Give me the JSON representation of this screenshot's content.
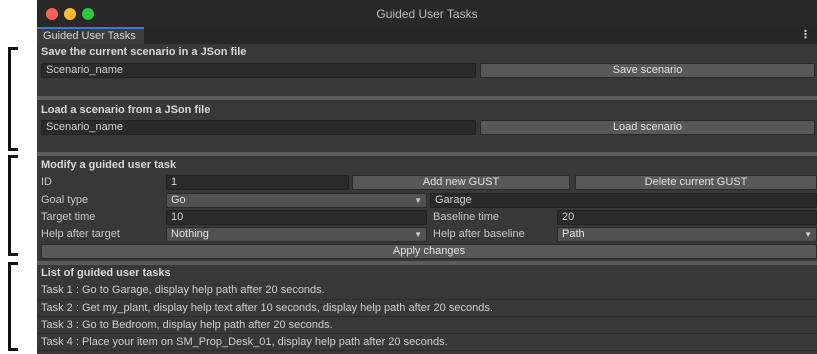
{
  "window": {
    "title": "Guided User Tasks",
    "tab_label": "Guided User Tasks",
    "tab_menu": "⋮"
  },
  "colors": {
    "close": "#ff5f57",
    "minimize": "#febc2e",
    "maximize": "#28c840",
    "accent": "#3a79d6"
  },
  "save_section": {
    "title": "Save the current scenario in a JSon file",
    "input_value": "Scenario_name",
    "button_label": "Save scenario"
  },
  "load_section": {
    "title": "Load a scenario from a JSon file",
    "input_value": "Scenario_name",
    "button_label": "Load scenario"
  },
  "modify_section": {
    "title": "Modify a guided user task",
    "id_label": "ID",
    "id_value": "1",
    "add_button": "Add new GUST",
    "delete_button": "Delete current GUST",
    "goal_type_label": "Goal type",
    "goal_type_value": "Go",
    "goal_target_value": "Garage",
    "target_time_label": "Target time",
    "target_time_value": "10",
    "baseline_time_label": "Baseline time",
    "baseline_time_value": "20",
    "help_after_target_label": "Help after target",
    "help_after_target_value": "Nothing",
    "help_after_baseline_label": "Help after baseline",
    "help_after_baseline_value": "Path",
    "apply_button": "Apply changes"
  },
  "list_section": {
    "title": "List of guided user tasks",
    "tasks": [
      "Task 1 : Go to Garage, display help path after 20 seconds.",
      "Task 2 : Get my_plant, display help text after 10 seconds, display help path after 20 seconds.",
      "Task 3 : Go to Bedroom, display help path after 20 seconds.",
      "Task 4 : Place your item on SM_Prop_Desk_01, display help path after 20 seconds."
    ]
  }
}
